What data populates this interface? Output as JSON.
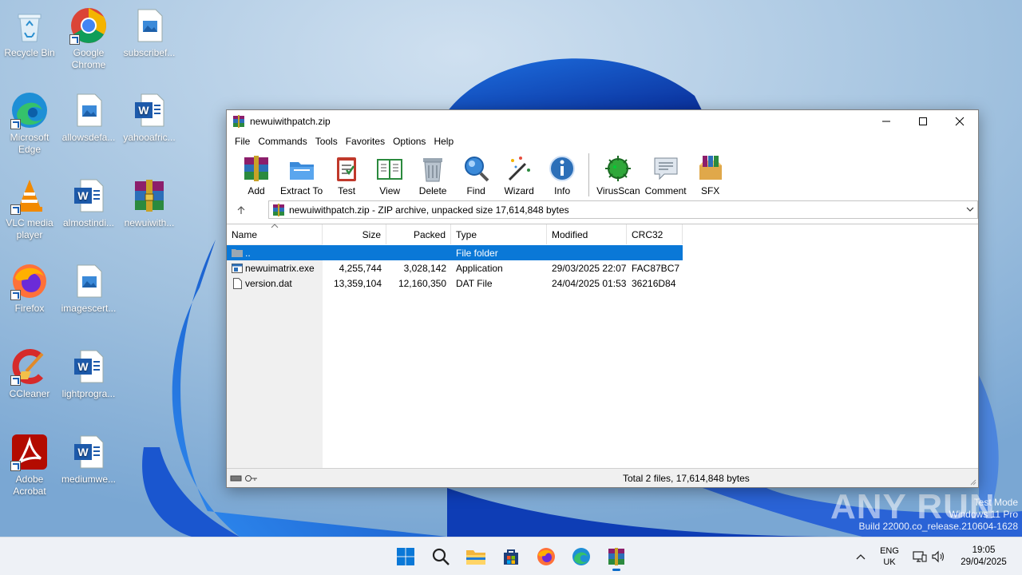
{
  "desktop": {
    "icons": [
      {
        "label": "Recycle Bin",
        "icon": "recycle-bin-icon"
      },
      {
        "label": "Google Chrome",
        "icon": "chrome-icon"
      },
      {
        "label": "subscribef...",
        "icon": "image-file-icon"
      },
      {
        "label": "Microsoft Edge",
        "icon": "edge-icon"
      },
      {
        "label": "allowsdefa...",
        "icon": "image-file-icon"
      },
      {
        "label": "yahooafric...",
        "icon": "word-doc-icon"
      },
      {
        "label": "VLC media player",
        "icon": "vlc-icon"
      },
      {
        "label": "almostindi...",
        "icon": "word-doc-icon"
      },
      {
        "label": "newuiwith...",
        "icon": "winrar-archive-icon"
      },
      {
        "label": "Firefox",
        "icon": "firefox-icon"
      },
      {
        "label": "imagescert...",
        "icon": "image-file-icon"
      },
      {
        "label": "CCleaner",
        "icon": "ccleaner-icon"
      },
      {
        "label": "lightprogra...",
        "icon": "word-doc-icon"
      },
      {
        "label": "Adobe Acrobat",
        "icon": "acrobat-icon"
      },
      {
        "label": "mediumwe...",
        "icon": "word-doc-icon"
      }
    ]
  },
  "window": {
    "title": "newuiwithpatch.zip",
    "menu": [
      "File",
      "Commands",
      "Tools",
      "Favorites",
      "Options",
      "Help"
    ],
    "toolbar": [
      {
        "label": "Add",
        "icon": "add-archive-icon"
      },
      {
        "label": "Extract To",
        "icon": "extract-folder-icon"
      },
      {
        "label": "Test",
        "icon": "test-clipboard-icon"
      },
      {
        "label": "View",
        "icon": "view-book-icon"
      },
      {
        "label": "Delete",
        "icon": "trash-icon"
      },
      {
        "label": "Find",
        "icon": "magnifier-icon"
      },
      {
        "label": "Wizard",
        "icon": "wand-icon"
      },
      {
        "label": "Info",
        "icon": "info-icon"
      },
      {
        "label": "VirusScan",
        "icon": "virus-scan-icon"
      },
      {
        "label": "Comment",
        "icon": "comment-icon"
      },
      {
        "label": "SFX",
        "icon": "sfx-box-icon"
      }
    ],
    "address": "newuiwithpatch.zip - ZIP archive, unpacked size 17,614,848 bytes",
    "columns": [
      "Name",
      "Size",
      "Packed",
      "Type",
      "Modified",
      "CRC32"
    ],
    "rows": [
      {
        "name": "..",
        "size": "",
        "packed": "",
        "type": "File folder",
        "modified": "",
        "crc": "",
        "selected": true
      },
      {
        "name": "newuimatrix.exe",
        "size": "4,255,744",
        "packed": "3,028,142",
        "type": "Application",
        "modified": "29/03/2025 22:07",
        "crc": "FAC87BC7",
        "selected": false
      },
      {
        "name": "version.dat",
        "size": "13,359,104",
        "packed": "12,160,350",
        "type": "DAT File",
        "modified": "24/04/2025 01:53",
        "crc": "36216D84",
        "selected": false
      }
    ],
    "status": "Total 2 files, 17,614,848 bytes"
  },
  "watermark": {
    "brand": "ANY RUN",
    "line1": "Test Mode",
    "line2": "Windows 11 Pro",
    "line3": "Build 22000.co_release.210604-1628"
  },
  "taskbar": {
    "apps": [
      "start-icon",
      "search-icon",
      "file-explorer-icon",
      "store-icon",
      "firefox-icon",
      "edge-icon",
      "winrar-icon"
    ],
    "lang1": "ENG",
    "lang2": "UK",
    "time": "19:05",
    "date": "29/04/2025"
  },
  "colors": {
    "selection": "#0a78d7",
    "taskbar": "#eef1f6"
  }
}
